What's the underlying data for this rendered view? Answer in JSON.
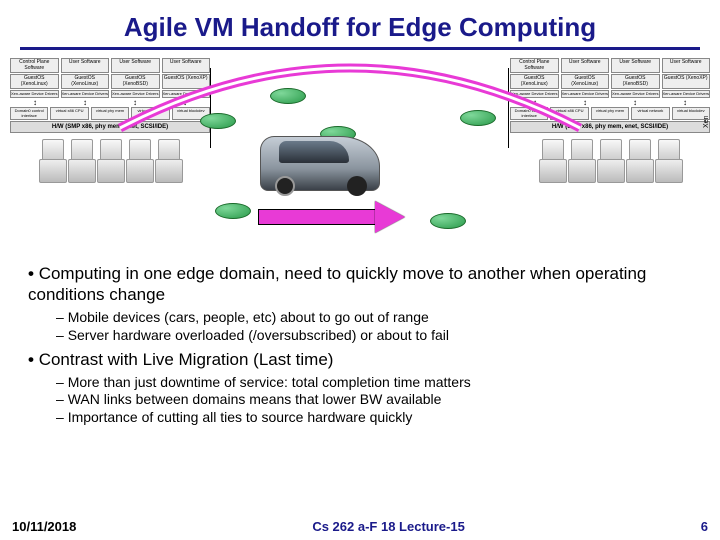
{
  "title": "Agile VM Handoff for Edge Computing",
  "domain": {
    "top_boxes": [
      "Control Plane Software",
      "User Software",
      "User Software",
      "User Software"
    ],
    "guest_boxes": [
      "GuestOS (XenoLinux)",
      "GuestOS (XenoLinux)",
      "GuestOS (XenoBSD)",
      "GuestOS (XenoXP)"
    ],
    "driver_boxes": [
      "Xen-aware Device Drivers",
      "Xen-aware Device Drivers",
      "Xen-aware Device Drivers",
      "Xen-aware Device Drivers"
    ],
    "mid_boxes": [
      "Domain0 control interface",
      "virtual x86 CPU",
      "virtual phy mem",
      "virtual network",
      "virtual blockdev"
    ],
    "hw": "H/W (SMP x86, phy mem, enet, SCSI/IDE)",
    "side_label_left": "Xen",
    "side_label_right": "Xen"
  },
  "bullets": {
    "b1": "Computing in one edge domain, need to quickly move to another when operating conditions change",
    "b1s1": "Mobile devices (cars, people, etc) about to go out of range",
    "b1s2": "Server hardware overloaded (/oversubscribed) or about to fail",
    "b2": "Contrast with Live Migration (Last time)",
    "b2s1": "More than just downtime of service: total completion time matters",
    "b2s2": "WAN links between domains means that lower BW available",
    "b2s3": "Importance of cutting all ties to source hardware quickly"
  },
  "footer": {
    "date": "10/11/2018",
    "mid": "Cs 262 a-F 18 Lecture-15",
    "page": "6"
  }
}
